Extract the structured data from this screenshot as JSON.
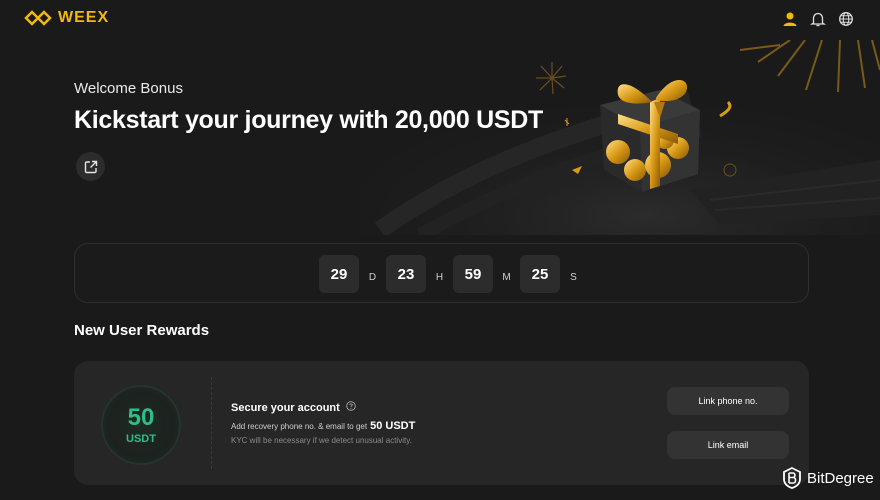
{
  "brand": {
    "name": "WEEX",
    "accent": "#f0b90b"
  },
  "header_icons": [
    "user-icon",
    "bell-icon",
    "globe-icon"
  ],
  "hero": {
    "eyebrow": "Welcome Bonus",
    "headline": "Kickstart your journey with 20,000 USDT",
    "share_icon": "share-icon"
  },
  "countdown": [
    {
      "value": "29",
      "unit": "D"
    },
    {
      "value": "23",
      "unit": "H"
    },
    {
      "value": "59",
      "unit": "M"
    },
    {
      "value": "25",
      "unit": "S"
    }
  ],
  "rewards": {
    "title": "New User Rewards",
    "card": {
      "amount": "50",
      "currency": "USDT",
      "task_title": "Secure your account",
      "desc_prefix": "Add recovery phone no. & email to get",
      "desc_amount": "50 USDT",
      "note": "KYC will be necessary if we detect unusual activity.",
      "buttons": {
        "phone": "Link phone no.",
        "email": "Link email"
      }
    }
  },
  "watermark": {
    "text": "BitDegree"
  },
  "colors": {
    "background": "#1a1a1a",
    "card": "#262626",
    "reward_green": "#2ebd85"
  }
}
